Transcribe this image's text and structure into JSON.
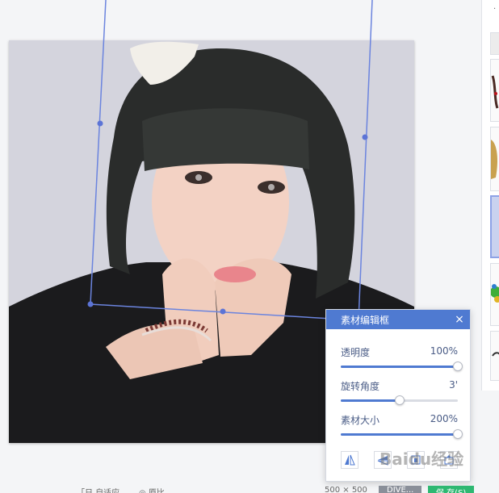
{
  "panel": {
    "title": "素材编辑框",
    "close_glyph": "×",
    "opacity": {
      "label": "透明度",
      "value_text": "100%",
      "level": 1.0
    },
    "rotation": {
      "label": "旋转角度",
      "value_text": "3'",
      "level": 0.5
    },
    "size": {
      "label": "素材大小",
      "value_text": "200%",
      "level": 1.0
    },
    "tools": [
      "flip-horizontal-icon",
      "flip-mirror-icon",
      "layer-down-icon",
      "layer-up-icon"
    ]
  },
  "watermark": {
    "text": "Baidu经验"
  },
  "bottom_bar": {
    "item_1": "「日 自适应",
    "item_2": "◎ 原比",
    "dims": "500 × 500",
    "gray_button": "DIVE...",
    "green_button": "保 存(S)"
  },
  "colors": {
    "accent": "#4f7ad1",
    "frame": "#6b84de",
    "panel_bg": "#ffffff"
  }
}
